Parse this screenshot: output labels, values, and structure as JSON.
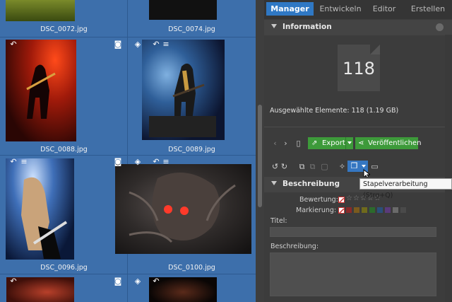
{
  "nav": {
    "tabs": [
      {
        "label": "Manager",
        "active": true
      },
      {
        "label": "Entwickeln",
        "active": false
      },
      {
        "label": "Editor",
        "active": false
      },
      {
        "label": "Erstellen",
        "active": false
      }
    ]
  },
  "grid": {
    "files": [
      {
        "name": "DSC_0072.jpg"
      },
      {
        "name": "DSC_0074.jpg"
      },
      {
        "name": "DSC_0088.jpg"
      },
      {
        "name": "DSC_0089.jpg"
      },
      {
        "name": "DSC_0096.jpg"
      },
      {
        "name": "DSC_0100.jpg"
      }
    ]
  },
  "panel": {
    "information": {
      "title": "Information",
      "count": "118",
      "summary": "Ausgewählte Elemente: 118 (1.19 GB)"
    },
    "actions": {
      "export_label": "Export",
      "publish_label": "Veröffentlichen"
    },
    "description": {
      "title": "Beschreibung",
      "rating_label": "Bewertung:",
      "marking_label": "Markierung:",
      "title_label": "Titel:",
      "description_label": "Beschreibung:",
      "rating_stars": 0,
      "colors": [
        "#8a2a2a",
        "#7a5a1e",
        "#6f6a1c",
        "#2c6a2c",
        "#2a4f7a",
        "#5a3a7a",
        "#6a6a6a",
        "#4a4a4a"
      ]
    },
    "tooltip": "Stapelverarbeitung (Strg+Q)"
  },
  "colors": {
    "accent": "#2f78c4",
    "grid_bg": "#3d6fab",
    "green": "#3d9a3a"
  }
}
